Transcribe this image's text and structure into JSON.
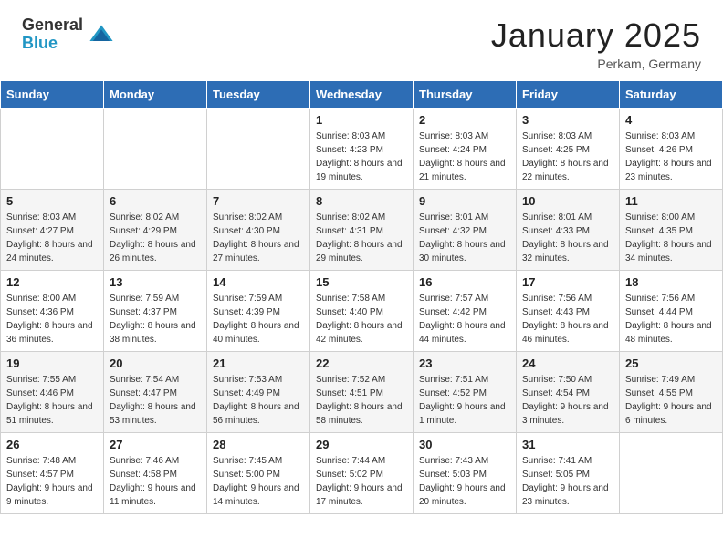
{
  "header": {
    "logo_general": "General",
    "logo_blue": "Blue",
    "month": "January 2025",
    "location": "Perkam, Germany"
  },
  "weekdays": [
    "Sunday",
    "Monday",
    "Tuesday",
    "Wednesday",
    "Thursday",
    "Friday",
    "Saturday"
  ],
  "weeks": [
    [
      {
        "day": null
      },
      {
        "day": null
      },
      {
        "day": null
      },
      {
        "day": "1",
        "sunrise": "8:03 AM",
        "sunset": "4:23 PM",
        "daylight": "8 hours and 19 minutes."
      },
      {
        "day": "2",
        "sunrise": "8:03 AM",
        "sunset": "4:24 PM",
        "daylight": "8 hours and 21 minutes."
      },
      {
        "day": "3",
        "sunrise": "8:03 AM",
        "sunset": "4:25 PM",
        "daylight": "8 hours and 22 minutes."
      },
      {
        "day": "4",
        "sunrise": "8:03 AM",
        "sunset": "4:26 PM",
        "daylight": "8 hours and 23 minutes."
      }
    ],
    [
      {
        "day": "5",
        "sunrise": "8:03 AM",
        "sunset": "4:27 PM",
        "daylight": "8 hours and 24 minutes."
      },
      {
        "day": "6",
        "sunrise": "8:02 AM",
        "sunset": "4:29 PM",
        "daylight": "8 hours and 26 minutes."
      },
      {
        "day": "7",
        "sunrise": "8:02 AM",
        "sunset": "4:30 PM",
        "daylight": "8 hours and 27 minutes."
      },
      {
        "day": "8",
        "sunrise": "8:02 AM",
        "sunset": "4:31 PM",
        "daylight": "8 hours and 29 minutes."
      },
      {
        "day": "9",
        "sunrise": "8:01 AM",
        "sunset": "4:32 PM",
        "daylight": "8 hours and 30 minutes."
      },
      {
        "day": "10",
        "sunrise": "8:01 AM",
        "sunset": "4:33 PM",
        "daylight": "8 hours and 32 minutes."
      },
      {
        "day": "11",
        "sunrise": "8:00 AM",
        "sunset": "4:35 PM",
        "daylight": "8 hours and 34 minutes."
      }
    ],
    [
      {
        "day": "12",
        "sunrise": "8:00 AM",
        "sunset": "4:36 PM",
        "daylight": "8 hours and 36 minutes."
      },
      {
        "day": "13",
        "sunrise": "7:59 AM",
        "sunset": "4:37 PM",
        "daylight": "8 hours and 38 minutes."
      },
      {
        "day": "14",
        "sunrise": "7:59 AM",
        "sunset": "4:39 PM",
        "daylight": "8 hours and 40 minutes."
      },
      {
        "day": "15",
        "sunrise": "7:58 AM",
        "sunset": "4:40 PM",
        "daylight": "8 hours and 42 minutes."
      },
      {
        "day": "16",
        "sunrise": "7:57 AM",
        "sunset": "4:42 PM",
        "daylight": "8 hours and 44 minutes."
      },
      {
        "day": "17",
        "sunrise": "7:56 AM",
        "sunset": "4:43 PM",
        "daylight": "8 hours and 46 minutes."
      },
      {
        "day": "18",
        "sunrise": "7:56 AM",
        "sunset": "4:44 PM",
        "daylight": "8 hours and 48 minutes."
      }
    ],
    [
      {
        "day": "19",
        "sunrise": "7:55 AM",
        "sunset": "4:46 PM",
        "daylight": "8 hours and 51 minutes."
      },
      {
        "day": "20",
        "sunrise": "7:54 AM",
        "sunset": "4:47 PM",
        "daylight": "8 hours and 53 minutes."
      },
      {
        "day": "21",
        "sunrise": "7:53 AM",
        "sunset": "4:49 PM",
        "daylight": "8 hours and 56 minutes."
      },
      {
        "day": "22",
        "sunrise": "7:52 AM",
        "sunset": "4:51 PM",
        "daylight": "8 hours and 58 minutes."
      },
      {
        "day": "23",
        "sunrise": "7:51 AM",
        "sunset": "4:52 PM",
        "daylight": "9 hours and 1 minute."
      },
      {
        "day": "24",
        "sunrise": "7:50 AM",
        "sunset": "4:54 PM",
        "daylight": "9 hours and 3 minutes."
      },
      {
        "day": "25",
        "sunrise": "7:49 AM",
        "sunset": "4:55 PM",
        "daylight": "9 hours and 6 minutes."
      }
    ],
    [
      {
        "day": "26",
        "sunrise": "7:48 AM",
        "sunset": "4:57 PM",
        "daylight": "9 hours and 9 minutes."
      },
      {
        "day": "27",
        "sunrise": "7:46 AM",
        "sunset": "4:58 PM",
        "daylight": "9 hours and 11 minutes."
      },
      {
        "day": "28",
        "sunrise": "7:45 AM",
        "sunset": "5:00 PM",
        "daylight": "9 hours and 14 minutes."
      },
      {
        "day": "29",
        "sunrise": "7:44 AM",
        "sunset": "5:02 PM",
        "daylight": "9 hours and 17 minutes."
      },
      {
        "day": "30",
        "sunrise": "7:43 AM",
        "sunset": "5:03 PM",
        "daylight": "9 hours and 20 minutes."
      },
      {
        "day": "31",
        "sunrise": "7:41 AM",
        "sunset": "5:05 PM",
        "daylight": "9 hours and 23 minutes."
      },
      {
        "day": null
      }
    ]
  ],
  "labels": {
    "sunrise_prefix": "Sunrise: ",
    "sunset_prefix": "Sunset: ",
    "daylight_prefix": "Daylight: "
  }
}
